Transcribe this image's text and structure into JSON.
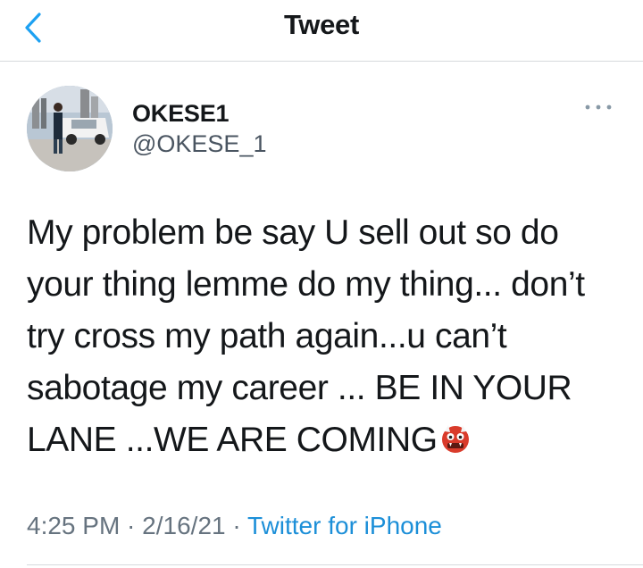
{
  "navbar": {
    "title": "Tweet",
    "back_icon": "chevron-left-icon",
    "accent": "#1DA1F2"
  },
  "tweet": {
    "display_name": "OKESE1",
    "handle": "@OKESE_1",
    "more_icon": "more-horizontal-icon",
    "text_lines": [
      "My problem be say U sell out so do",
      "your thing lemme do my thing... don’t",
      "try cross my path again...u can’t",
      "sabotage my career ... BE IN YOUR",
      "LANE ...WE ARE COMING"
    ],
    "trailing_emoji": "ogre-emoji",
    "time": "4:25 PM",
    "separator": " · ",
    "date": "2/16/21",
    "source": "Twitter for iPhone"
  }
}
